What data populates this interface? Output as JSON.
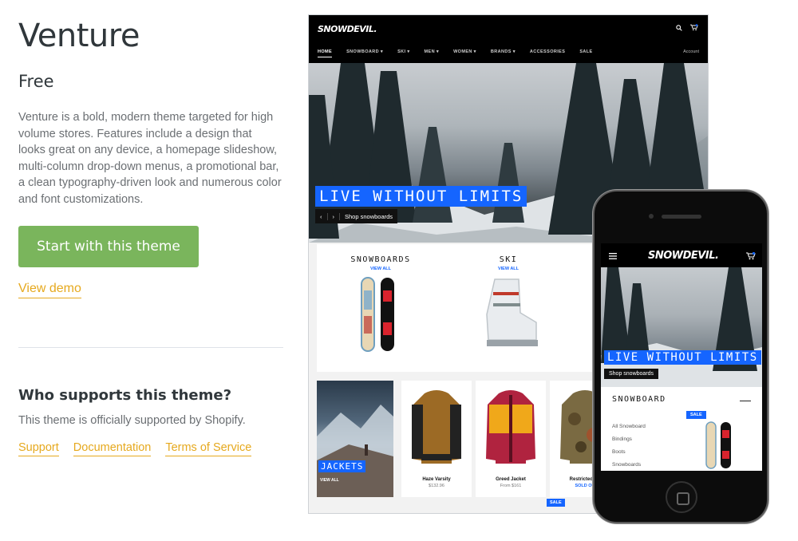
{
  "theme": {
    "name": "Venture",
    "price": "Free",
    "description": "Venture is a bold, modern theme targeted for high volume stores. Features include a design that looks great on any device, a homepage slideshow, multi-column drop-down menus, a promotional bar, a clean typography-driven look and numerous color and font customizations.",
    "cta_label": "Start with this theme",
    "demo_label": "View demo"
  },
  "support": {
    "heading": "Who supports this theme?",
    "text": "This theme is officially supported by Shopify.",
    "links": [
      "Support",
      "Documentation",
      "Terms of Service"
    ]
  },
  "preview": {
    "brand": "SNOWDEVIL.",
    "nav": [
      "HOME",
      "SNOWBOARD ▾",
      "SKI ▾",
      "MEN ▾",
      "WOMEN ▾",
      "BRANDS ▾",
      "ACCESSORIES",
      "SALE"
    ],
    "account": "Account",
    "hero_title": "LIVE WITHOUT LIMITS",
    "hero_button": "Shop snowboards",
    "hero_prev": "‹",
    "hero_next": "›",
    "categories": [
      {
        "title": "SNOWBOARDS",
        "link": "VIEW ALL"
      },
      {
        "title": "SKI",
        "link": "VIEW ALL"
      }
    ],
    "collection_tile": {
      "title": "JACKETS",
      "link": "VIEW ALL"
    },
    "products": [
      {
        "name": "Haze Varsity",
        "price": "$132.96"
      },
      {
        "name": "Greed Jacket",
        "price": "From $161"
      },
      {
        "name": "Restricted Po",
        "price": "SOLD OU"
      }
    ],
    "sale_badge": "SALE"
  },
  "mobile": {
    "brand": "SNOWDEVIL.",
    "hero_title": "LIVE WITHOUT LIMITS",
    "hero_button": "Shop snowboards",
    "category_title": "SNOWBOARD",
    "collapse_symbol": "—",
    "sale_badge": "SALE",
    "list": [
      "All Snowboard",
      "Bindings",
      "Boots",
      "Snowboards"
    ]
  },
  "colors": {
    "cta_green": "#7ab55c",
    "link_gold": "#e6a91e",
    "hero_blue": "#1565ff"
  }
}
